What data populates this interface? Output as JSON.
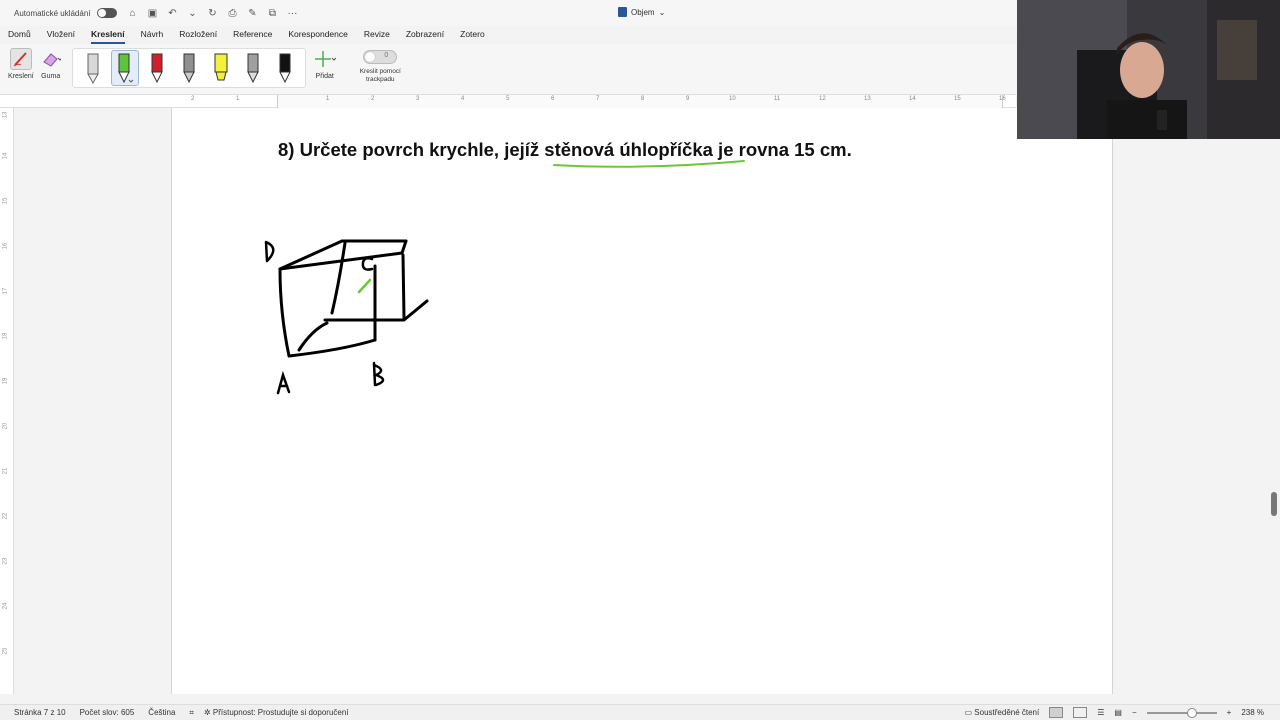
{
  "titlebar": {
    "autosave_label": "Automatické ukládání",
    "document_title": "Objem"
  },
  "tabs": [
    {
      "label": "Domů"
    },
    {
      "label": "Vložení"
    },
    {
      "label": "Kreslení",
      "active": true
    },
    {
      "label": "Návrh"
    },
    {
      "label": "Rozložení"
    },
    {
      "label": "Reference"
    },
    {
      "label": "Korespondence"
    },
    {
      "label": "Revize"
    },
    {
      "label": "Zobrazení"
    },
    {
      "label": "Zotero"
    }
  ],
  "ribbon": {
    "draw_label": "Kreslení",
    "eraser_label": "Guma",
    "add_label": "Přidat",
    "trackpad_label_line1": "Kreslit pomocí",
    "trackpad_label_line2": "trackpadu",
    "trackpad_toggle_text": "0",
    "pens": [
      {
        "name": "pencil-gray",
        "color": "#c8c8c8"
      },
      {
        "name": "pen-green",
        "color": "#5ec43b",
        "selected": true
      },
      {
        "name": "pen-red",
        "color": "#d0202e"
      },
      {
        "name": "pencil-gray-2",
        "color": "#909090"
      },
      {
        "name": "highlighter-yellow",
        "color": "#f5f03a"
      },
      {
        "name": "pencil-gray-3",
        "color": "#a0a0a0"
      },
      {
        "name": "pen-black",
        "color": "#111111"
      }
    ]
  },
  "ruler": {
    "numbers": [
      "2",
      "1",
      "1",
      "2",
      "3",
      "4",
      "5",
      "6",
      "7",
      "8",
      "9",
      "10",
      "11",
      "12",
      "13",
      "14",
      "15",
      "16"
    ]
  },
  "vruler": {
    "numbers": [
      "13",
      "14",
      "15",
      "16",
      "17",
      "18",
      "19",
      "20",
      "21",
      "22",
      "23",
      "24",
      "25"
    ]
  },
  "document": {
    "question": "8)  Určete povrch krychle, jejíž stěnová úhlopříčka je rovna 15 cm.",
    "handwritten_labels": [
      "D",
      "C",
      "A",
      "B"
    ]
  },
  "statusbar": {
    "page": "Stránka 7 z 10",
    "words": "Počet slov: 605",
    "language": "Čeština",
    "accessibility": "Přístupnost: Prostudujte si doporučení",
    "focus": "Soustředěné čtení",
    "zoom": "238 %"
  },
  "colors": {
    "accent": "#2b579a",
    "ink_black": "#000000",
    "ink_green": "#6cc733"
  }
}
